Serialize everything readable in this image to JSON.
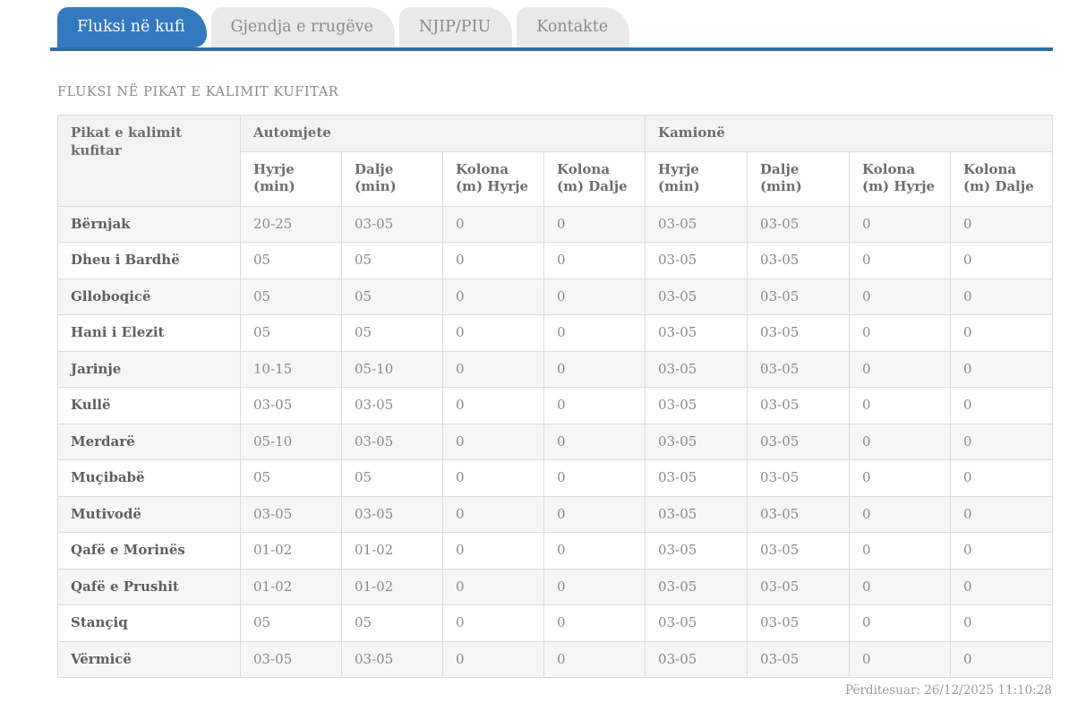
{
  "tabs": [
    {
      "label": "Fluksi në kufi",
      "active": true
    },
    {
      "label": "Gjendja e rrugëve",
      "active": false
    },
    {
      "label": "NJIP/PIU",
      "active": false
    },
    {
      "label": "Kontakte",
      "active": false
    }
  ],
  "page_title": "FLUKSI NË PIKAT E KALIMIT KUFITAR",
  "table": {
    "corner_header": "Pikat e kalimit kufitar",
    "groups": [
      {
        "label": "Automjete"
      },
      {
        "label": "Kamionë"
      }
    ],
    "sub_headers": [
      "Hyrje (min)",
      "Dalje (min)",
      "Kolona (m) Hyrje",
      "Kolona (m) Dalje"
    ],
    "rows": [
      {
        "name": "Bërnjak",
        "automjete": [
          "20-25",
          "03-05",
          "0",
          "0"
        ],
        "kamione": [
          "03-05",
          "03-05",
          "0",
          "0"
        ]
      },
      {
        "name": "Dheu i Bardhë",
        "automjete": [
          "05",
          "05",
          "0",
          "0"
        ],
        "kamione": [
          "03-05",
          "03-05",
          "0",
          "0"
        ]
      },
      {
        "name": "Glloboqicë",
        "automjete": [
          "05",
          "05",
          "0",
          "0"
        ],
        "kamione": [
          "03-05",
          "03-05",
          "0",
          "0"
        ]
      },
      {
        "name": "Hani i Elezit",
        "automjete": [
          "05",
          "05",
          "0",
          "0"
        ],
        "kamione": [
          "03-05",
          "03-05",
          "0",
          "0"
        ]
      },
      {
        "name": "Jarinje",
        "automjete": [
          "10-15",
          "05-10",
          "0",
          "0"
        ],
        "kamione": [
          "03-05",
          "03-05",
          "0",
          "0"
        ]
      },
      {
        "name": "Kullë",
        "automjete": [
          "03-05",
          "03-05",
          "0",
          "0"
        ],
        "kamione": [
          "03-05",
          "03-05",
          "0",
          "0"
        ]
      },
      {
        "name": "Merdarë",
        "automjete": [
          "05-10",
          "03-05",
          "0",
          "0"
        ],
        "kamione": [
          "03-05",
          "03-05",
          "0",
          "0"
        ]
      },
      {
        "name": "Muçibabë",
        "automjete": [
          "05",
          "05",
          "0",
          "0"
        ],
        "kamione": [
          "03-05",
          "03-05",
          "0",
          "0"
        ]
      },
      {
        "name": "Mutivodë",
        "automjete": [
          "03-05",
          "03-05",
          "0",
          "0"
        ],
        "kamione": [
          "03-05",
          "03-05",
          "0",
          "0"
        ]
      },
      {
        "name": "Qafë e Morinës",
        "automjete": [
          "01-02",
          "01-02",
          "0",
          "0"
        ],
        "kamione": [
          "03-05",
          "03-05",
          "0",
          "0"
        ]
      },
      {
        "name": "Qafë e Prushit",
        "automjete": [
          "01-02",
          "01-02",
          "0",
          "0"
        ],
        "kamione": [
          "03-05",
          "03-05",
          "0",
          "0"
        ]
      },
      {
        "name": "Stançiq",
        "automjete": [
          "05",
          "05",
          "0",
          "0"
        ],
        "kamione": [
          "03-05",
          "03-05",
          "0",
          "0"
        ]
      },
      {
        "name": "Vërmicë",
        "automjete": [
          "03-05",
          "03-05",
          "0",
          "0"
        ],
        "kamione": [
          "03-05",
          "03-05",
          "0",
          "0"
        ]
      }
    ]
  },
  "footer": {
    "updated_text": "Përditesuar: 26/12/2025 11:10:28"
  },
  "colors": {
    "active_tab": "#3379bf",
    "tab_underline": "#2e6da4",
    "inactive_tab_bg": "#e9e9e9",
    "header_bg": "#f3f3f3",
    "zebra_row_bg": "#f6f6f6",
    "border": "#dcdcdc",
    "text_muted": "#8a8a8a"
  }
}
